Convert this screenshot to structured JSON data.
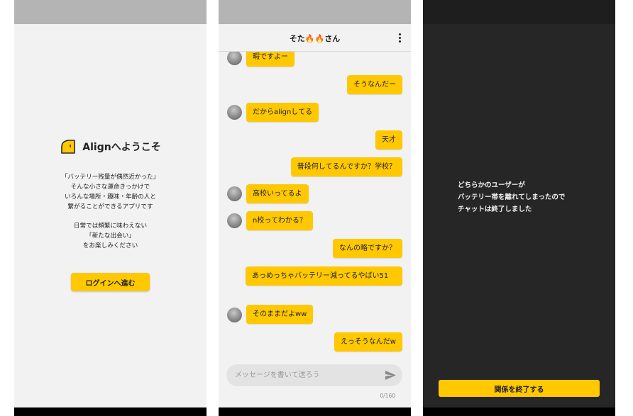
{
  "welcome": {
    "title": "Alignへようこそ",
    "intro_lines": [
      "「バッテリー残量が偶然近かった」",
      "そんな小さな運命きっかけで",
      "いろんな場所・趣味・年齢の人と",
      "繋がることができるアプリです"
    ],
    "intro_lines2": [
      "日常では頻繁に味わえない",
      "「新たな出会い」",
      "をお楽しみください"
    ],
    "login_button": "ログインへ進む"
  },
  "chat": {
    "title": "そた🔥🔥さん",
    "messages": [
      {
        "side": "left",
        "text": "暇ですよー"
      },
      {
        "side": "right",
        "text": "そうなんだー"
      },
      {
        "side": "left",
        "text": "だからalignしてる"
      },
      {
        "side": "right",
        "text": "天才"
      },
      {
        "side": "right",
        "text": "普段何してるんですか？学校？"
      },
      {
        "side": "left",
        "text": "高校いってるよ"
      },
      {
        "side": "left",
        "text": "n校ってわかる？"
      },
      {
        "side": "right",
        "text": "なんの略ですか？"
      },
      {
        "side": "right",
        "text": "あっめっちゃバッテリー減ってるやばい51"
      },
      {
        "side": "left",
        "text": "そのままだよww"
      },
      {
        "side": "right",
        "text": "えっそうなんだw"
      }
    ],
    "input_placeholder": "メッセージを書いて送ろう",
    "char_count": "0/160"
  },
  "ended": {
    "message_lines": [
      "どちらかのユーザーが",
      "バッテリー帯を離れてしまったので",
      "チャットは終了しました"
    ],
    "end_button": "関係を終了する"
  },
  "colors": {
    "accent": "#ffc800",
    "screen_bg": "#f2f2f2",
    "dark_bg": "#262626",
    "text": "#222222"
  },
  "icons": {
    "logo": "align-logo-icon",
    "menu": "kebab-menu-icon",
    "send": "send-icon",
    "avatar": "user-avatar"
  }
}
